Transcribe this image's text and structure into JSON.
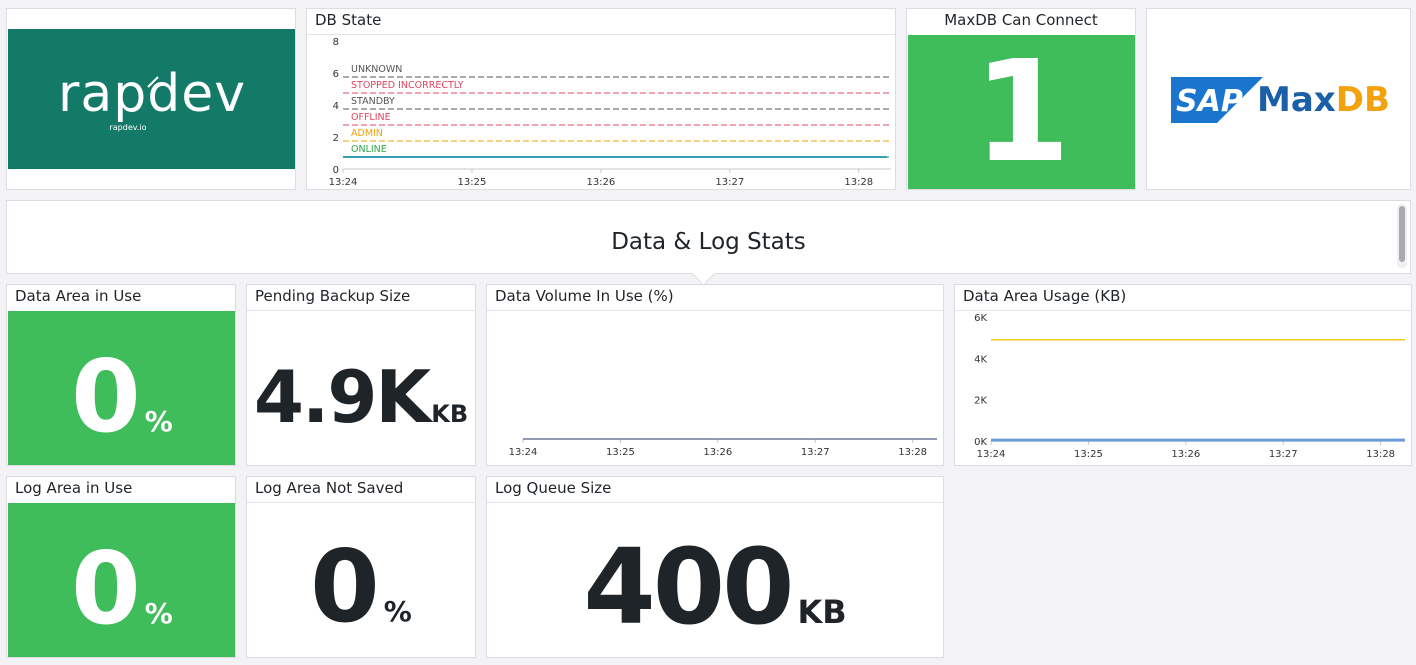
{
  "logo_rapdev": {
    "wordmark": "rapdev",
    "url": "rapdev.io",
    "bg": "#137a68"
  },
  "db_state": {
    "title": "DB State",
    "chart_data": {
      "type": "line",
      "x_ticks": [
        "13:24",
        "13:25",
        "13:26",
        "13:27",
        "13:28"
      ],
      "y_ticks": [
        0,
        2,
        4,
        6,
        8
      ],
      "ylim": [
        0,
        8
      ],
      "grid": false,
      "thresholds": [
        {
          "label": "UNKNOWN",
          "value": 6,
          "color": "#555555"
        },
        {
          "label": "STOPPED INCORRECTLY",
          "value": 5,
          "color": "#e0455f"
        },
        {
          "label": "STANDBY",
          "value": 4,
          "color": "#555555"
        },
        {
          "label": "OFFLINE",
          "value": 3,
          "color": "#e0455f"
        },
        {
          "label": "ADMIN",
          "value": 2,
          "color": "#f2a20c"
        },
        {
          "label": "ONLINE",
          "value": 1,
          "color": "#2aa845"
        }
      ],
      "series": [
        {
          "values": [
            1,
            1,
            1,
            1,
            1,
            1
          ],
          "color": "#3a9fb3"
        }
      ]
    }
  },
  "can_connect": {
    "title": "MaxDB Can Connect",
    "value": "1",
    "color": "#3ebd5a"
  },
  "logo_sap": {
    "sap": "SAP",
    "product": "MaxDB"
  },
  "section": {
    "title": "Data & Log Stats"
  },
  "data_area_in_use": {
    "title": "Data Area in Use",
    "value": "0",
    "unit": "%"
  },
  "pending_backup": {
    "title": "Pending Backup Size",
    "value": "4.9K",
    "unit": "KB"
  },
  "data_volume": {
    "title": "Data Volume In Use (%)",
    "chart_data": {
      "type": "line",
      "x_ticks": [
        "13:24",
        "13:25",
        "13:26",
        "13:27",
        "13:28"
      ],
      "series": [
        {
          "values": [
            0,
            0,
            0,
            0,
            0,
            0
          ],
          "color": "#6b7a99"
        }
      ]
    }
  },
  "data_area_usage": {
    "title": "Data Area Usage (KB)",
    "chart_data": {
      "type": "line",
      "x_ticks": [
        "13:24",
        "13:25",
        "13:26",
        "13:27",
        "13:28"
      ],
      "y_ticks": [
        "0K",
        "2K",
        "4K",
        "6K"
      ],
      "ylim": [
        0,
        6000
      ],
      "series": [
        {
          "values": [
            4900,
            4900,
            4900,
            4900,
            4900,
            4900
          ],
          "color": "#f2c81c"
        },
        {
          "values": [
            40,
            40,
            40,
            40,
            40,
            40
          ],
          "color": "#6b9bd8"
        }
      ]
    }
  },
  "log_area_in_use": {
    "title": "Log Area in Use",
    "value": "0",
    "unit": "%"
  },
  "log_not_saved": {
    "title": "Log Area Not Saved",
    "value": "0",
    "unit": "%"
  },
  "log_queue": {
    "title": "Log Queue Size",
    "value": "400",
    "unit": "KB"
  }
}
